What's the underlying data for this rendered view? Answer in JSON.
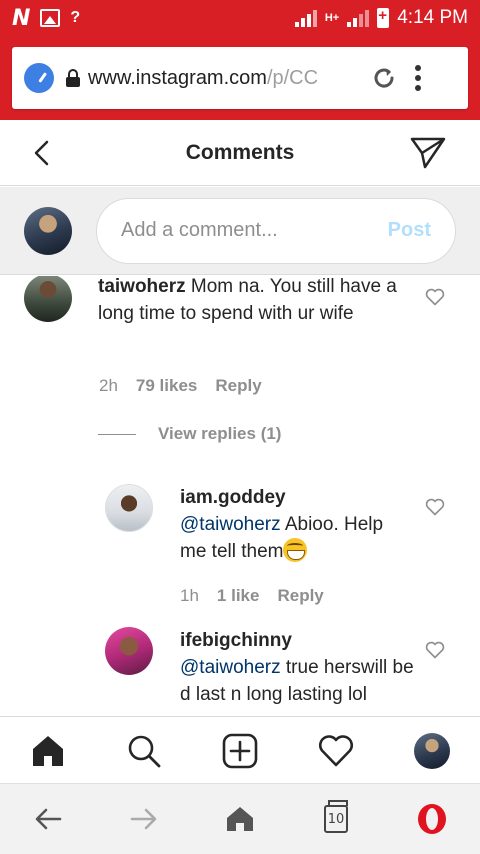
{
  "status_bar": {
    "network_type": "H+",
    "time": "4:14 PM"
  },
  "browser": {
    "url_main": "www.instagram.com",
    "url_dim": "/p/CC"
  },
  "header": {
    "title": "Comments"
  },
  "add_comment": {
    "placeholder": "Add a comment...",
    "post_label": "Post"
  },
  "comments": [
    {
      "username": "taiwoherz",
      "text": "Mom na. You still have a long time to spend with ur wife",
      "time": "2h",
      "likes": "79 likes",
      "reply_label": "Reply",
      "view_replies": "View replies (1)"
    },
    {
      "username": "iam.goddey",
      "mention": "@taiwoherz",
      "text": "Abioo. Help me tell them",
      "time": "1h",
      "likes": "1 like",
      "reply_label": "Reply"
    },
    {
      "username": "ifebigchinny",
      "mention": "@taiwoherz",
      "text": "true herswill be d last n long lasting lol",
      "time": "",
      "likes": "",
      "reply_label": ""
    }
  ],
  "ig_nav": {
    "items": [
      "home-icon",
      "search-icon",
      "new-post-icon",
      "activity-icon",
      "profile-avatar"
    ]
  },
  "opera_bar": {
    "tabs_count": "10"
  },
  "colors": {
    "status_bar": "#d81f26",
    "post_disabled": "#b2dffc",
    "mention": "#003569",
    "opera_red": "#e0141e"
  }
}
